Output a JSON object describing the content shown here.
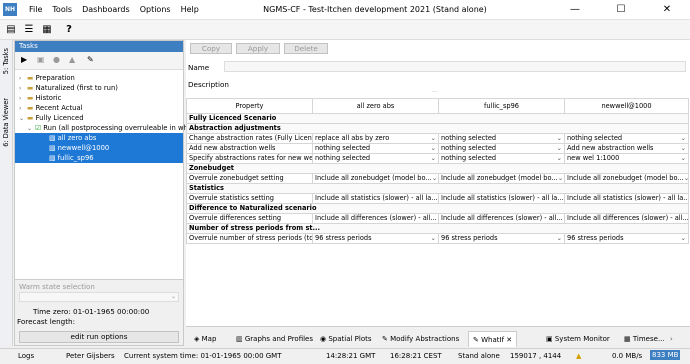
{
  "window": {
    "logo": "NH",
    "title": "NGMS-CF - Test-Itchen development 2021  (Stand alone)"
  },
  "menu": [
    "File",
    "Tools",
    "Dashboards",
    "Options",
    "Help"
  ],
  "side_tabs": {
    "tasks": "5: Tasks",
    "data_viewer": "6: Data Viewer"
  },
  "tasks": {
    "title": "Tasks",
    "tree": [
      {
        "label": "Preparation",
        "level": 0,
        "expander": "›"
      },
      {
        "label": "Naturalized (first to run)",
        "level": 0,
        "expander": "›"
      },
      {
        "label": "Historic",
        "level": 0,
        "expander": "›"
      },
      {
        "label": "Recent Actual",
        "level": 0,
        "expander": "›"
      },
      {
        "label": "Fully Licenced",
        "level": 0,
        "expander": "⌄"
      },
      {
        "label": "Run (all postprocessing overruleable in whatif)",
        "level": 1,
        "expander": "⌄"
      },
      {
        "label": "all zero abs",
        "level": 2,
        "selected": true
      },
      {
        "label": "newwell@1000",
        "level": 2,
        "selected": true
      },
      {
        "label": "fullic_sp96",
        "level": 2,
        "selected": true
      }
    ],
    "warm_state_label": "Warm state selection",
    "time_zero_label": "Time zero:",
    "time_zero_value": "01-01-1965 00:00:00",
    "forecast_length_label": "Forecast length:",
    "edit_button": "edit run options"
  },
  "main": {
    "buttons": {
      "copy": "Copy",
      "apply": "Apply",
      "delete": "Delete"
    },
    "name_label": "Name",
    "description_label": "Description",
    "headers": [
      "Property",
      "all zero abs",
      "fullic_sp96",
      "newwell@1000"
    ],
    "rows": [
      {
        "type": "group",
        "label": "Fully Licenced Scenario"
      },
      {
        "type": "group",
        "label": "Abstraction adjustments"
      },
      {
        "type": "row",
        "label": "Change abstraction rates (Fully Licens...",
        "values": [
          "replace all abs by zero",
          "nothing selected",
          "nothing selected"
        ]
      },
      {
        "type": "row",
        "label": "Add new abstraction wells",
        "values": [
          "nothing selected",
          "nothing selected",
          "Add new abstraction wells"
        ]
      },
      {
        "type": "row",
        "label": "Specify abstractions rates for new well...",
        "values": [
          "nothing selected",
          "nothing selected",
          "new wel 1:1000"
        ]
      },
      {
        "type": "group",
        "label": "Zonebudget"
      },
      {
        "type": "row",
        "label": "Overrule zonebudget setting",
        "values": [
          "Include all zonebudget (model bo...",
          "Include all zonebudget (model bo...",
          "Include all zonebudget (model bo..."
        ]
      },
      {
        "type": "group",
        "label": "Statistics"
      },
      {
        "type": "row",
        "label": "Overrule statistics setting",
        "values": [
          "Include all statistics (slower) - all la...",
          "Include all statistics (slower) - all la...",
          "Include all statistics (slower) - all la..."
        ]
      },
      {
        "type": "group",
        "label": "Difference to Naturalized scenario"
      },
      {
        "type": "row",
        "label": "Overrule differences setting",
        "values": [
          "Include all differences (slower) - all...",
          "Include all differences (slower) - all...",
          "Include all differences (slower) - all..."
        ]
      },
      {
        "type": "group",
        "label": "Number of stress periods from st..."
      },
      {
        "type": "row",
        "label": "Overrule number of stress periods (to...",
        "values": [
          "96 stress periods",
          "96 stress periods",
          "96 stress periods"
        ]
      }
    ]
  },
  "bottom_tabs": [
    "Map",
    "Graphs and Profiles",
    "Spatial Plots",
    "Modify Abstractions",
    "WhatIf",
    "System Monitor",
    "Timese..."
  ],
  "status": {
    "logs": "Logs",
    "user": "Peter Gijsbers",
    "system_time": "Current system time: 01-01-1965 00:00 GMT",
    "time1": "14:28:21 GMT",
    "time2": "16:28:21 CEST",
    "mode": "Stand alone",
    "coords": "159017 , 4144",
    "rate": "0.0 MB/s",
    "memory": "833 MB"
  }
}
